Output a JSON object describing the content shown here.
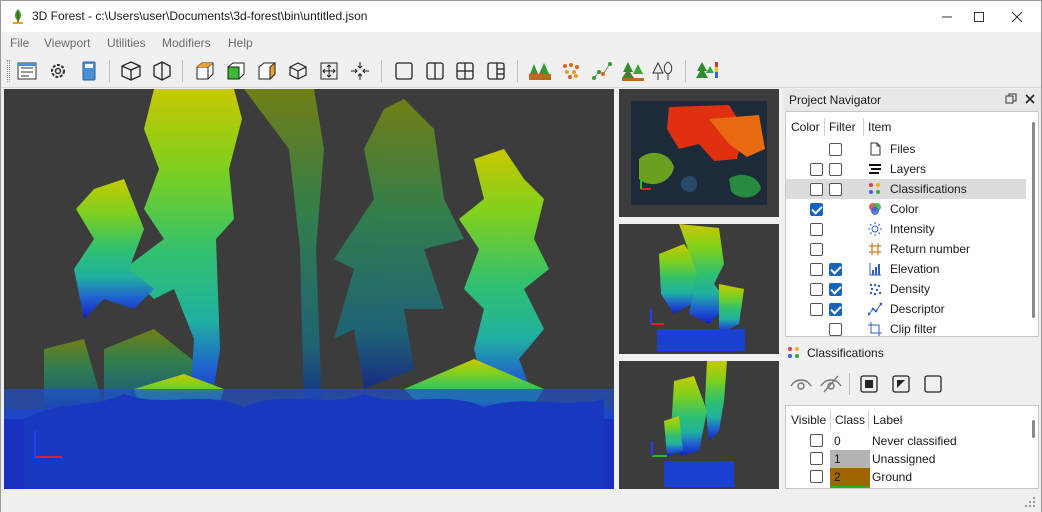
{
  "window": {
    "title": "3D Forest - c:\\Users\\user\\Documents\\3d-forest\\bin\\untitled.json",
    "controls": [
      "minimize-icon",
      "maximize-icon",
      "close-icon"
    ]
  },
  "menu": {
    "items": [
      "File",
      "Viewport",
      "Utilities",
      "Modifiers",
      "Help"
    ]
  },
  "toolbar": {
    "groups": [
      [
        "project-icon",
        "settings-icon",
        "manual-icon"
      ],
      [
        "perspective-view-icon",
        "orthographic-view-icon"
      ],
      [
        "top-view-icon",
        "front-view-icon",
        "side-view-icon",
        "3d-view-icon",
        "zoom-extents-icon",
        "center-view-icon"
      ],
      [
        "single-layout-icon",
        "two-columns-layout-icon",
        "grid-layout-icon",
        "three-views-layout-icon"
      ],
      [
        "ground-icon",
        "clusters-icon",
        "descriptor-icon",
        "trees-icon",
        "crown-icon"
      ],
      [
        "tree-attributes-icon"
      ]
    ]
  },
  "navigator": {
    "title": "Project Navigator",
    "columns": {
      "color": "Color",
      "filter": "Filter",
      "item": "Item"
    },
    "items": [
      {
        "label": "Files",
        "icon": "file-icon",
        "color": null,
        "filter": false
      },
      {
        "label": "Layers",
        "icon": "layers-icon",
        "color": false,
        "filter": false
      },
      {
        "label": "Classifications",
        "icon": "classifications-icon",
        "color": false,
        "filter": false,
        "selected": true
      },
      {
        "label": "Color",
        "icon": "color-icon",
        "color": true,
        "filter": null
      },
      {
        "label": "Intensity",
        "icon": "intensity-icon",
        "color": false,
        "filter": null
      },
      {
        "label": "Return number",
        "icon": "return-number-icon",
        "color": false,
        "filter": null
      },
      {
        "label": "Elevation",
        "icon": "elevation-icon",
        "color": false,
        "filter": true
      },
      {
        "label": "Density",
        "icon": "density-icon",
        "color": false,
        "filter": true
      },
      {
        "label": "Descriptor",
        "icon": "descriptor-icon",
        "color": false,
        "filter": true
      },
      {
        "label": "Clip filter",
        "icon": "clip-filter-icon",
        "color": null,
        "filter": false
      }
    ]
  },
  "classifications": {
    "title": "Classifications",
    "tools": [
      "show-all-icon",
      "hide-all-icon",
      "select-all-icon",
      "invert-selection-icon",
      "select-none-icon"
    ],
    "columns": {
      "visible": "Visible",
      "class": "Class",
      "label": "Label"
    },
    "rows": [
      {
        "class": "0",
        "label": "Never classified",
        "color": "#ffffff"
      },
      {
        "class": "1",
        "label": "Unassigned",
        "color": "#b4b4b4"
      },
      {
        "class": "2",
        "label": "Ground",
        "color": "#a06400"
      }
    ]
  },
  "colors": {
    "accent": "#1565c0",
    "viewport_background": "#3c3c3c"
  }
}
